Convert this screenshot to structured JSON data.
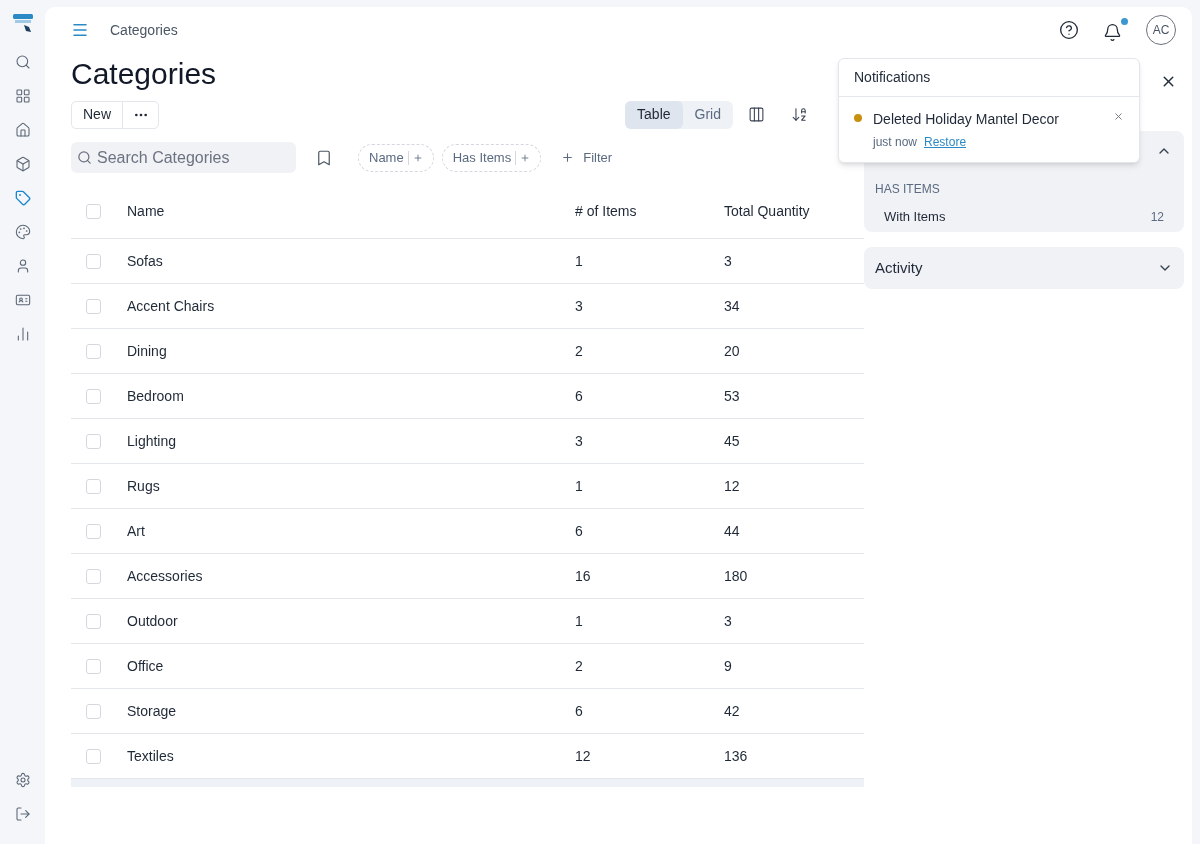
{
  "sidebar": {
    "items": [
      {
        "selected": false
      },
      {
        "selected": false
      },
      {
        "selected": false
      },
      {
        "selected": false
      },
      {
        "selected": true
      },
      {
        "selected": false
      },
      {
        "selected": false
      },
      {
        "selected": false
      },
      {
        "selected": false
      }
    ],
    "bottom_items": [
      {
        "selected": false
      },
      {
        "selected": false
      }
    ]
  },
  "topbar": {
    "breadcrumb": "Categories",
    "avatar": "AC",
    "bell_unread": true
  },
  "page": {
    "title": "Categories",
    "new_button": "New"
  },
  "view_toggle": [
    {
      "label": "Table",
      "selected": true
    },
    {
      "label": "Grid",
      "selected": false
    }
  ],
  "search": {
    "placeholder": "Search Categories"
  },
  "filter_chips": [
    "Name",
    "Has Items"
  ],
  "add_filter": "Filter",
  "table": {
    "columns": [
      "Name",
      "# of Items",
      "Total Quantity"
    ],
    "header_checked": false,
    "rows": [
      {
        "name": "Sofas",
        "items": "1",
        "quantity": "3",
        "checked": false
      },
      {
        "name": "Accent Chairs",
        "items": "3",
        "quantity": "34",
        "checked": false
      },
      {
        "name": "Dining",
        "items": "2",
        "quantity": "20",
        "checked": false
      },
      {
        "name": "Bedroom",
        "items": "6",
        "quantity": "53",
        "checked": false
      },
      {
        "name": "Lighting",
        "items": "3",
        "quantity": "45",
        "checked": false
      },
      {
        "name": "Rugs",
        "items": "1",
        "quantity": "12",
        "checked": false
      },
      {
        "name": "Art",
        "items": "6",
        "quantity": "44",
        "checked": false
      },
      {
        "name": "Accessories",
        "items": "16",
        "quantity": "180",
        "checked": false
      },
      {
        "name": "Outdoor",
        "items": "1",
        "quantity": "3",
        "checked": false
      },
      {
        "name": "Office",
        "items": "2",
        "quantity": "9",
        "checked": false
      },
      {
        "name": "Storage",
        "items": "6",
        "quantity": "42",
        "checked": false
      },
      {
        "name": "Textiles",
        "items": "12",
        "quantity": "136",
        "checked": false
      }
    ]
  },
  "summary": {
    "expanded": true,
    "group": "HAS ITEMS",
    "items": [
      {
        "label": "With Items",
        "count": "12"
      }
    ]
  },
  "activity": {
    "title": "Activity",
    "expanded": false
  },
  "notifications": {
    "title": "Notifications",
    "items": [
      {
        "message": "Deleted Holiday Mantel Decor",
        "time": "just now",
        "action": "Restore",
        "unread": true
      }
    ]
  }
}
